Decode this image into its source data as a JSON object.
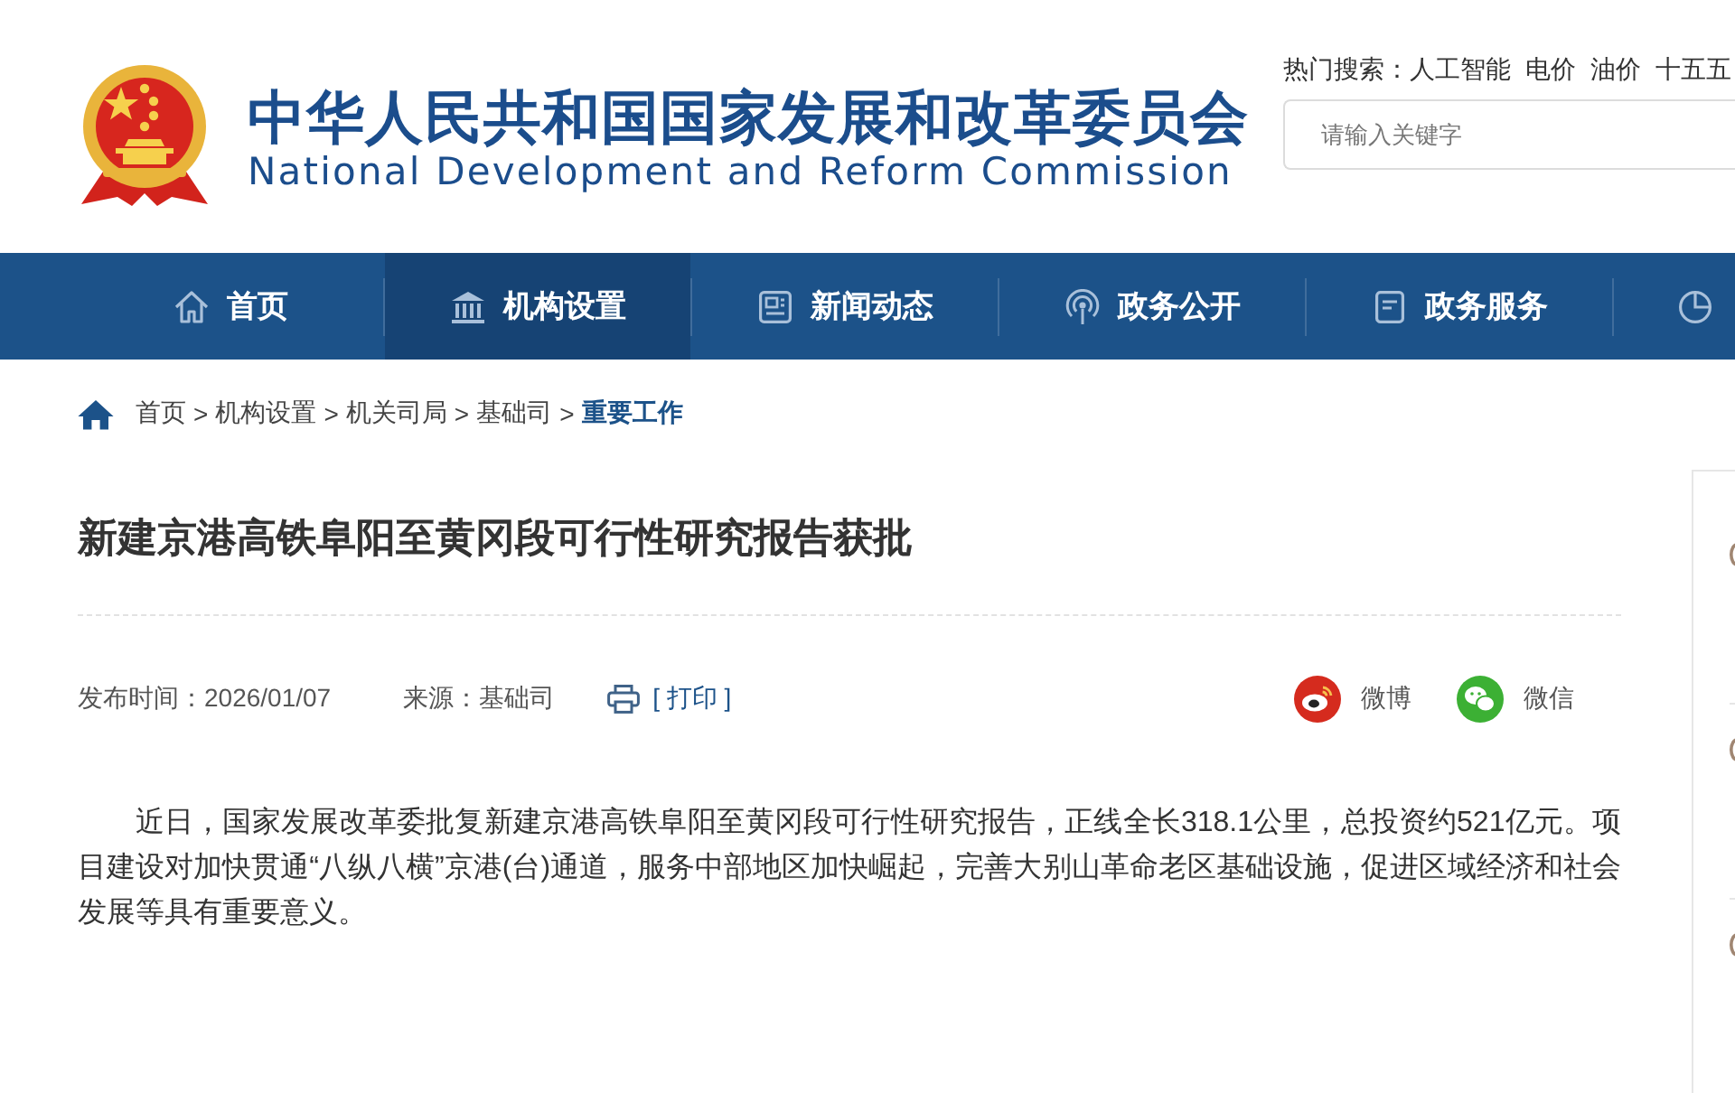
{
  "header": {
    "title": "中华人民共和国国家发展和改革委员会",
    "subtitle": "National Development and Reform Commission",
    "hot_search": {
      "label": "热门搜索：",
      "terms": [
        "人工智能",
        "电价",
        "油价",
        "十五五"
      ]
    },
    "search": {
      "placeholder": "请输入关键字"
    }
  },
  "nav": [
    {
      "label": "首页",
      "selected": false
    },
    {
      "label": "机构设置",
      "selected": true
    },
    {
      "label": "新闻动态",
      "selected": false
    },
    {
      "label": "政务公开",
      "selected": false
    },
    {
      "label": "政务服务",
      "selected": false
    },
    {
      "selected": false
    }
  ],
  "breadcrumb": [
    {
      "label": "首页",
      "current": false,
      "separator": ">"
    },
    {
      "label": "机构设置",
      "current": false,
      "separator": ">"
    },
    {
      "label": "机关司局",
      "current": false,
      "separator": ">"
    },
    {
      "label": "基础司",
      "current": false,
      "separator": ">"
    },
    {
      "label": "重要工作",
      "current": true
    }
  ],
  "article": {
    "title": "新建京港高铁阜阳至黄冈段可行性研究报告获批",
    "published": "发布时间：2026/01/07",
    "source": "来源：基础司",
    "print": "[ 打印 ]",
    "share": [
      {
        "kind": "weibo",
        "label": "微博"
      },
      {
        "kind": "wechat",
        "label": "微信"
      }
    ],
    "body": [
      "近日，国家发展改革委批复新建京港高铁阜阳至黄冈段可行性研究报告，正线全长318.1公里，总投资约521亿元。项目建设对加快贯通“八纵八横”京港(台)通道，服务中部地区加快崛起，完善大别山革命老区基础设施，促进区域经济和社会发展等具有重要意义。"
    ]
  }
}
